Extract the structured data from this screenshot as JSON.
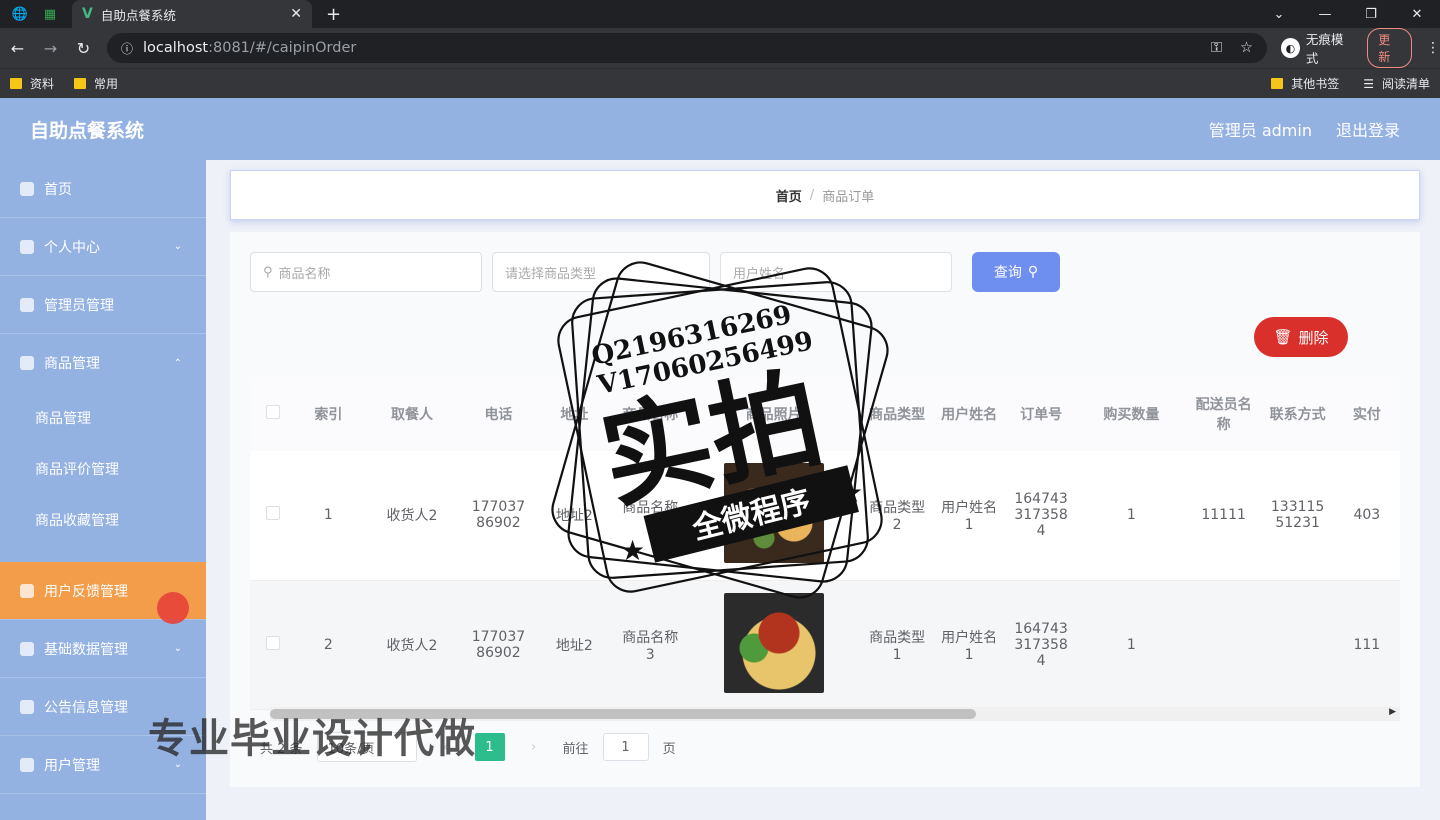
{
  "browser": {
    "tab_title": "自助点餐系统",
    "url_host": "localhost",
    "url_path": ":8081/#/caipinOrder",
    "incognito_label": "无痕模式",
    "update_label": "更新",
    "bookmarks": [
      "资料",
      "常用"
    ],
    "bookmarks_right": [
      "其他书签",
      "阅读清单"
    ]
  },
  "app": {
    "brand": "自助点餐系统",
    "user_label": "管理员 admin",
    "logout_label": "退出登录"
  },
  "sidebar": {
    "items": [
      {
        "label": "首页"
      },
      {
        "label": "个人中心"
      },
      {
        "label": "管理员管理"
      },
      {
        "label": "商品管理"
      }
    ],
    "sub_items": [
      "商品管理",
      "商品评价管理",
      "商品收藏管理"
    ],
    "items_after": [
      {
        "label": "用户反馈管理"
      },
      {
        "label": "基础数据管理"
      },
      {
        "label": "公告信息管理"
      },
      {
        "label": "用户管理"
      }
    ]
  },
  "breadcrumb": {
    "home": "首页",
    "sep": "/",
    "current": "商品订单"
  },
  "search": {
    "name_placeholder": "商品名称",
    "type_placeholder": "请选择商品类型",
    "user_placeholder": "用户姓名",
    "query_label": "查询"
  },
  "delete_label": "删除",
  "table": {
    "headers": [
      "索引",
      "取餐人",
      "电话",
      "地址",
      "商品名称",
      "商品照片",
      "商品类型",
      "用户姓名",
      "订单号",
      "购买数量",
      "配送员名称",
      "联系方式",
      "实付"
    ],
    "rows": [
      {
        "index": "1",
        "receiver": "收货人2",
        "phone": "17703786902",
        "address": "地址2",
        "goods": "商品名称2",
        "type": "商品类型2",
        "user": "用户姓名1",
        "order": "1647433173584",
        "qty": "1",
        "courier": "11111",
        "contact": "13311551231",
        "paid": "403"
      },
      {
        "index": "2",
        "receiver": "收货人2",
        "phone": "17703786902",
        "address": "地址2",
        "goods": "商品名称3",
        "type": "商品类型1",
        "user": "用户姓名1",
        "order": "1647433173584",
        "qty": "1",
        "courier": "",
        "contact": "",
        "paid": "111"
      }
    ]
  },
  "pager": {
    "total": "共 2 条",
    "size": "10条/页",
    "page": "1",
    "goto_prefix": "前往",
    "goto_value": "1",
    "goto_suffix": "页"
  },
  "overlay": {
    "contact_q": "Q2196316269",
    "contact_v": "V17060256499",
    "stamp_big": "实拍",
    "stamp_banner": "全微程序",
    "bottom": "专业毕业设计代做"
  }
}
